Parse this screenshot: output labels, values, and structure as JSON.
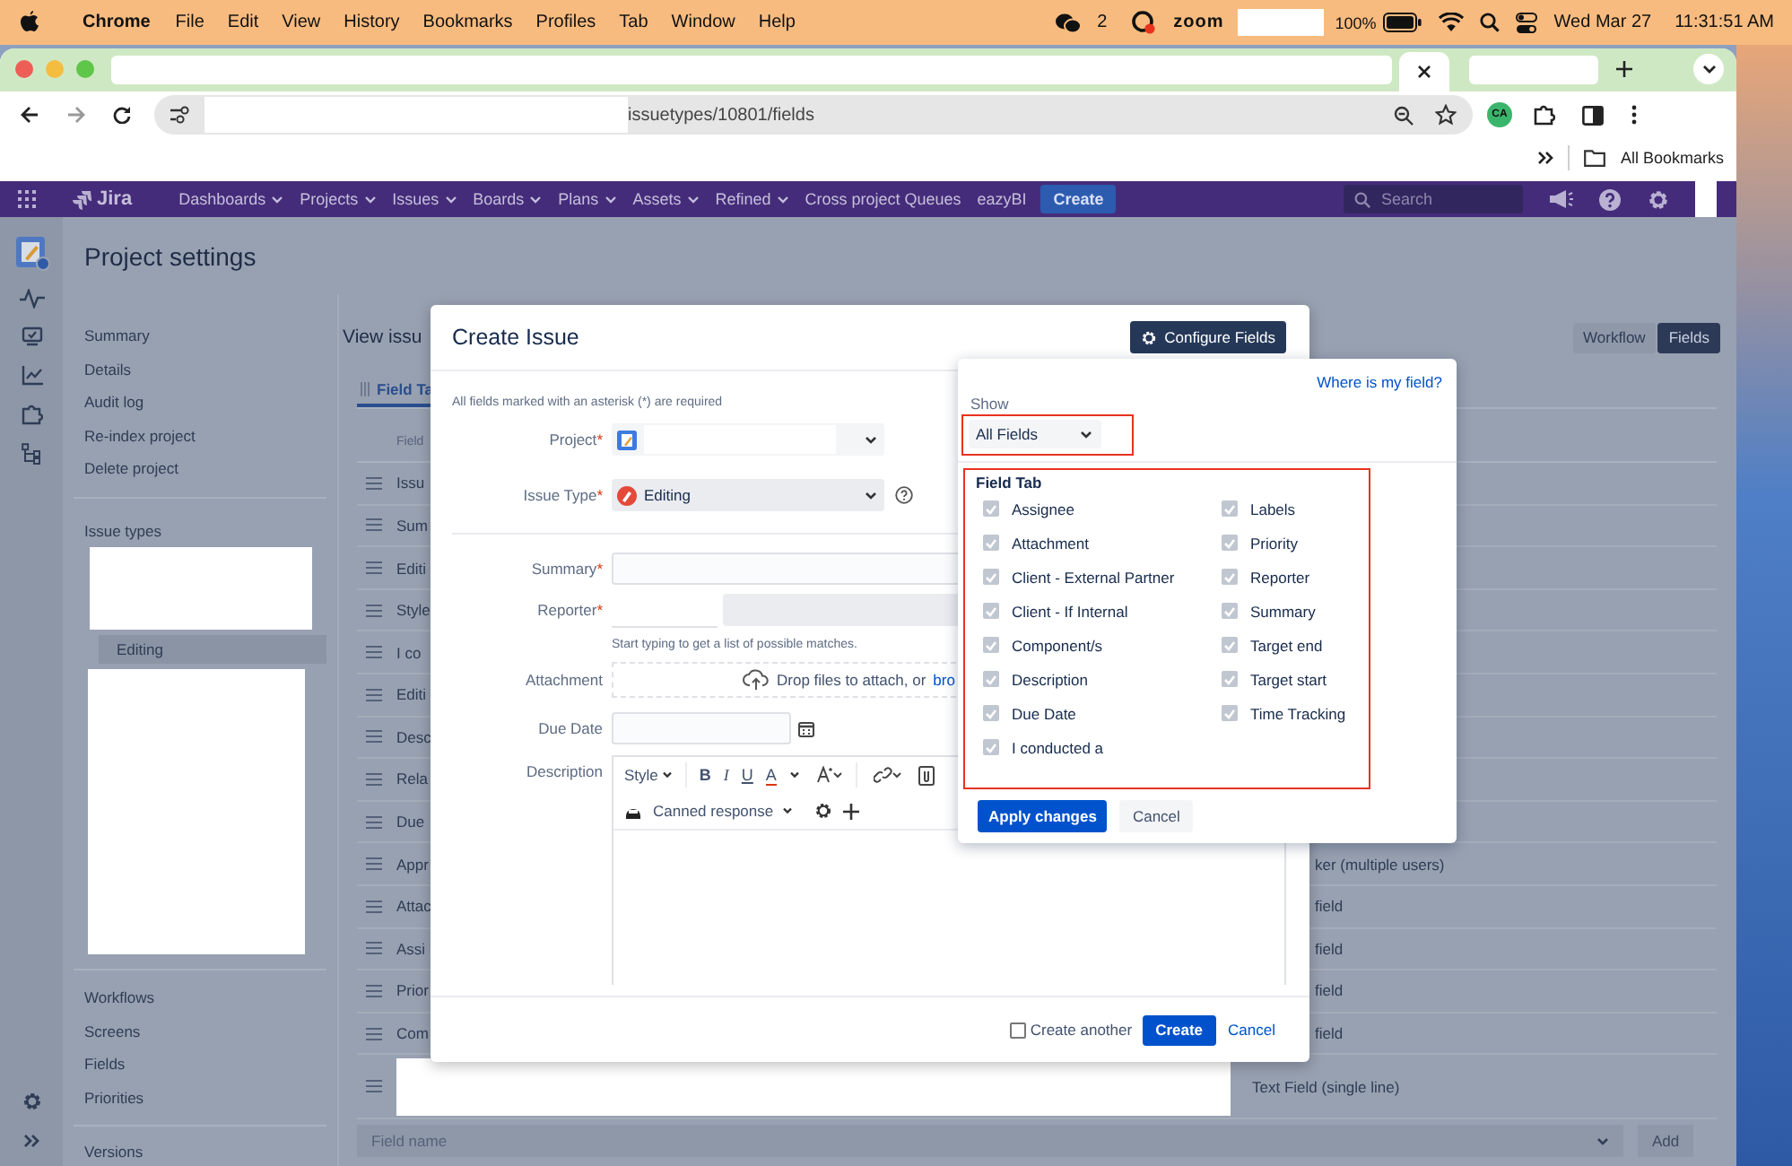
{
  "menubar": {
    "app": "Chrome",
    "menus": [
      "File",
      "Edit",
      "View",
      "History",
      "Bookmarks",
      "Profiles",
      "Tab",
      "Window",
      "Help"
    ],
    "chat_count": "2",
    "zoom": "zoom",
    "battery": "100%",
    "date": "Wed Mar 27",
    "time": "11:31:51 AM"
  },
  "browser": {
    "url": "issuetypes/10801/fields",
    "profile": "CA",
    "bookmarks": "All Bookmarks"
  },
  "jira_nav": {
    "logo": "Jira",
    "items": [
      {
        "label": "Dashboards",
        "dropdown": true
      },
      {
        "label": "Projects",
        "dropdown": true
      },
      {
        "label": "Issues",
        "dropdown": true
      },
      {
        "label": "Boards",
        "dropdown": true
      },
      {
        "label": "Plans",
        "dropdown": true
      },
      {
        "label": "Assets",
        "dropdown": true
      },
      {
        "label": "Refined",
        "dropdown": true
      },
      {
        "label": "Cross project Queues",
        "dropdown": false
      },
      {
        "label": "eazyBI",
        "dropdown": false
      }
    ],
    "create": "Create",
    "search_placeholder": "Search"
  },
  "sidebar": {
    "title": "Project settings",
    "items": [
      "Summary",
      "Details",
      "Audit log",
      "Re-index project",
      "Delete project"
    ],
    "section": "Issue types",
    "issue_types": [
      {
        "label": "Editing",
        "selected": true
      }
    ],
    "items_lower": [
      "Workflows",
      "Screens",
      "Fields",
      "Priorities"
    ],
    "items_bottom": [
      "Versions"
    ]
  },
  "page": {
    "heading": "View issu",
    "views": [
      {
        "label": "Workflow",
        "selected": false
      },
      {
        "label": "Fields",
        "selected": true
      }
    ],
    "tab": "Field Ta",
    "column_1": "Field",
    "rows": [
      {
        "left": "Issu"
      },
      {
        "left": "Sum"
      },
      {
        "left": "Editi"
      },
      {
        "left": "Style"
      },
      {
        "left": "I co"
      },
      {
        "left": "Editi"
      },
      {
        "left": "Desc"
      },
      {
        "left": "Rela"
      },
      {
        "left": "Due"
      },
      {
        "left": "Appr",
        "right": "ker (multiple users)"
      },
      {
        "left": "Attac",
        "right": "field"
      },
      {
        "left": "Assi",
        "right": "field"
      },
      {
        "left": "Prior",
        "right": "field"
      },
      {
        "left": "Com",
        "right": "field"
      }
    ],
    "last_row": "Text Field (single line)",
    "field_name_placeholder": "Field name",
    "add": "Add"
  },
  "modal": {
    "title": "Create Issue",
    "configure": "Configure Fields",
    "required_mark": "*",
    "note": "All fields marked with an asterisk (*) are required",
    "fields": [
      {
        "kind": "project",
        "label": "Project",
        "required": true
      },
      {
        "kind": "issuetype",
        "label": "Issue Type",
        "required": true,
        "value": "Editing"
      },
      {
        "kind": "text",
        "label": "Summary",
        "required": true
      },
      {
        "kind": "user",
        "label": "Reporter",
        "required": true,
        "hint": "Start typing to get a list of possible matches."
      },
      {
        "kind": "attachment",
        "label": "Attachment",
        "required": false,
        "text": "Drop files to attach, or",
        "link": "bro"
      },
      {
        "kind": "date",
        "label": "Due Date",
        "required": false
      },
      {
        "kind": "richtext",
        "label": "Description",
        "required": false,
        "style": "Style",
        "format": [
          "B",
          "I",
          "U",
          "A"
        ],
        "canned": "Canned response"
      }
    ],
    "create_another": {
      "label": "Create another",
      "checked": false
    },
    "create": "Create",
    "cancel": "Cancel"
  },
  "config_popup": {
    "help_link": "Where is my field?",
    "show_label": "Show",
    "show_value": "All Fields",
    "show_highlighted": true,
    "group": "Field Tab",
    "group_highlighted": true,
    "fields": [
      {
        "label": "Assignee",
        "checked": true
      },
      {
        "label": "Attachment",
        "checked": true
      },
      {
        "label": "Client - External Partner",
        "checked": true
      },
      {
        "label": "Client - If Internal",
        "checked": true
      },
      {
        "label": "Component/s",
        "checked": true
      },
      {
        "label": "Description",
        "checked": true
      },
      {
        "label": "Due Date",
        "checked": true
      },
      {
        "label": "I conducted a",
        "checked": true
      },
      {
        "label": "Labels",
        "checked": true
      },
      {
        "label": "Priority",
        "checked": true
      },
      {
        "label": "Reporter",
        "checked": true
      },
      {
        "label": "Summary",
        "checked": true
      },
      {
        "label": "Target end",
        "checked": true
      },
      {
        "label": "Target start",
        "checked": true
      },
      {
        "label": "Time Tracking",
        "checked": true
      }
    ],
    "apply": "Apply changes",
    "cancel": "Cancel"
  }
}
